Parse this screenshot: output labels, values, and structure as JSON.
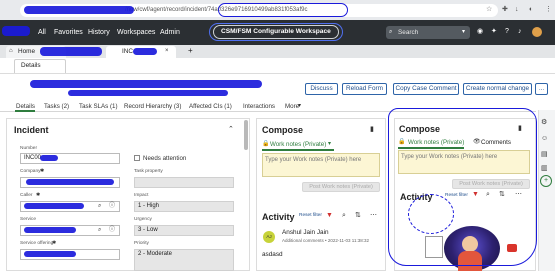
{
  "browser": {
    "url": "/now/cwf/agent/record/incident/74a0326e9716910499ab831f053af9c",
    "icons": [
      "refresh-icon",
      "lock-icon",
      "star-icon",
      "extensions-icon",
      "download-icon",
      "profile-icon",
      "more-icon"
    ]
  },
  "menubar": {
    "items": [
      "All",
      "Favorites",
      "History",
      "Workspaces",
      "Admin"
    ],
    "workspace_title": "CSM/FSM Configurable Workspace",
    "search_placeholder": "Search"
  },
  "tabs": {
    "home": "Home",
    "incident": "INC",
    "add": "+"
  },
  "subtabs": {
    "details": "Details"
  },
  "actions": {
    "discuss": "Discuss",
    "reload": "Reload Form",
    "copy_comment": "Copy Case Comment",
    "normal_change": "Create normal change",
    "more": "..."
  },
  "form_tabs": [
    "Details",
    "Tasks (2)",
    "Task SLAs (1)",
    "Record Hierarchy (3)",
    "Affected CIs (1)",
    "Interactions",
    "More"
  ],
  "incident": {
    "title": "Incident",
    "number_label": "Number",
    "number_value": "INC00",
    "needs_attention": "Needs attention",
    "company_label": "Company",
    "task_property_label": "Task property",
    "caller_label": "Caller",
    "impact_label": "Impact",
    "impact_value": "1 - High",
    "service_label": "Service",
    "urgency_label": "Urgency",
    "urgency_value": "3 - Low",
    "service_offering_label": "Service offering",
    "priority_label": "Priority",
    "priority_value": "2 - Moderate"
  },
  "compose_left": {
    "title": "Compose",
    "notes_type": "Work notes (Private)",
    "placeholder": "Type your Work notes (Private) here",
    "post": "Post Work notes (Private)"
  },
  "activity": {
    "title": "Activity",
    "reset": "Reset filter",
    "author": "Anshul Jain Jain",
    "meta": "Additional comments • 2022-11-03 11:38:32",
    "text": "asdasd",
    "avatar": "AJ"
  },
  "compose_right": {
    "title": "Compose",
    "notes_type": "Work notes (Private)",
    "comments": "Comments",
    "placeholder": "Type your Work notes (Private) here",
    "post": "Post Work notes (Private)",
    "activity_title": "Activity",
    "reset": "Reset filter"
  },
  "colors": {
    "header_bg": "#2b2f33",
    "accent": "#1a1adb",
    "field_green": "#2f7d3e",
    "note_bg": "#fcf6d4"
  }
}
